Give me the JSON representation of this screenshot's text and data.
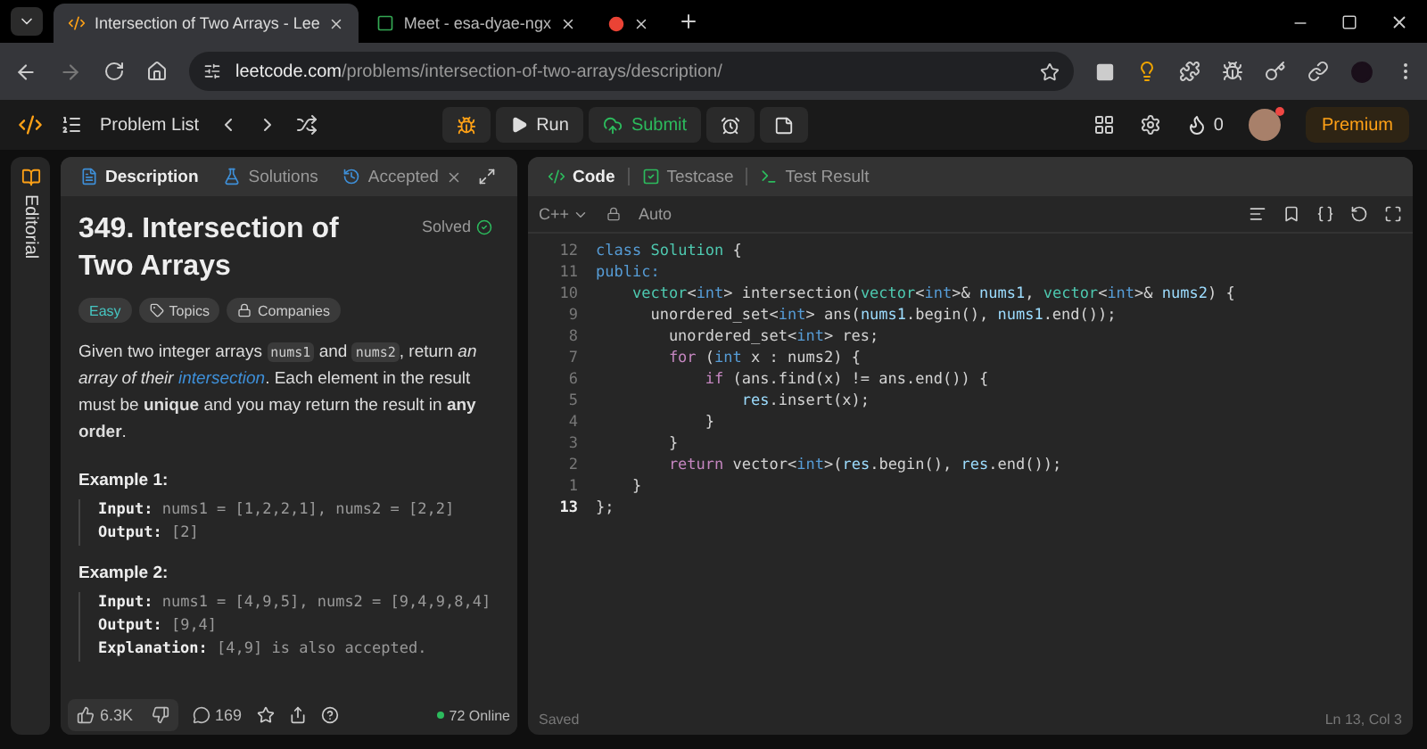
{
  "browser": {
    "tabs": [
      {
        "title": "Intersection of Two Arrays - Lee",
        "kind": "leetcode",
        "selected": true
      },
      {
        "title": "Meet - esa-dyae-ngx",
        "kind": "meet",
        "selected": false
      },
      {
        "kind": "recording",
        "selected": false
      }
    ],
    "url": {
      "domain": "leetcode.com",
      "path": "/problems/intersection-of-two-arrays/description/"
    }
  },
  "nav": {
    "problem_list": "Problem List",
    "run": "Run",
    "submit": "Submit",
    "streak": "0",
    "premium": "Premium"
  },
  "side_tab": "Editorial",
  "problem": {
    "tabs": [
      {
        "label": "Description",
        "kind": "description",
        "selected": true
      },
      {
        "label": "Solutions",
        "kind": "solutions",
        "selected": false
      },
      {
        "label": "Accepted",
        "kind": "accepted",
        "selected": false
      }
    ],
    "title": "349. Intersection of Two Arrays",
    "status": "Solved",
    "tags": [
      {
        "label": "Easy",
        "kind": "difficulty"
      },
      {
        "label": "Topics",
        "kind": "topics"
      },
      {
        "label": "Companies",
        "kind": "companies"
      }
    ],
    "description": [
      {
        "kind": "text",
        "text": "Given two integer arrays "
      },
      {
        "kind": "code",
        "text": "nums1"
      },
      {
        "kind": "text",
        "text": " and "
      },
      {
        "kind": "code",
        "text": "nums2"
      },
      {
        "kind": "text",
        "text": ", return *an array of their* "
      },
      {
        "kind": "link",
        "text": "intersection"
      },
      {
        "kind": "text",
        "text": ". Each element in the result must be **unique** and you may return the result in **any order**."
      }
    ],
    "examples": [
      {
        "title": "Example 1:",
        "lines": [
          {
            "label": "Input:",
            "value": "nums1 = [1,2,2,1], nums2 = [2,2]"
          },
          {
            "label": "Output:",
            "value": "[2]"
          }
        ]
      },
      {
        "title": "Example 2:",
        "lines": [
          {
            "label": "Input:",
            "value": "nums1 = [4,9,5], nums2 = [9,4,9,8,4]"
          },
          {
            "label": "Output:",
            "value": "[9,4]"
          },
          {
            "label": "Explanation:",
            "value": "[4,9] is also accepted."
          }
        ]
      }
    ],
    "footer": {
      "likes": "6.3K",
      "comments": "169",
      "online": "72 Online"
    }
  },
  "editor": {
    "tabs": [
      {
        "label": "Code",
        "kind": "code",
        "selected": true
      },
      {
        "label": "Testcase",
        "kind": "testcase",
        "selected": false
      },
      {
        "label": "Test Result",
        "kind": "result",
        "selected": false
      }
    ],
    "language": "C++",
    "mode": "Auto",
    "lines": [
      {
        "number": "12",
        "current": false,
        "tokens": [
          {
            "kind": "keyword",
            "t": "class "
          },
          {
            "kind": "type",
            "t": "Solution"
          },
          {
            "kind": "plain",
            "t": " {"
          }
        ]
      },
      {
        "number": "11",
        "current": false,
        "tokens": [
          {
            "kind": "keyword",
            "t": "public:"
          }
        ]
      },
      {
        "number": "10",
        "current": false,
        "tokens": [
          {
            "kind": "type",
            "t": "    vector"
          },
          {
            "kind": "plain",
            "t": "<"
          },
          {
            "kind": "keyword",
            "t": "int"
          },
          {
            "kind": "plain",
            "t": "> intersection("
          },
          {
            "kind": "type",
            "t": "vector"
          },
          {
            "kind": "plain",
            "t": "<"
          },
          {
            "kind": "keyword",
            "t": "int"
          },
          {
            "kind": "plain",
            "t": ">& "
          },
          {
            "kind": "variable",
            "t": "nums1"
          },
          {
            "kind": "plain",
            "t": ", "
          },
          {
            "kind": "type",
            "t": "vector"
          },
          {
            "kind": "plain",
            "t": "<"
          },
          {
            "kind": "keyword",
            "t": "int"
          },
          {
            "kind": "plain",
            "t": ">& "
          },
          {
            "kind": "variable",
            "t": "nums2"
          },
          {
            "kind": "plain",
            "t": ") {"
          }
        ]
      },
      {
        "number": "9",
        "current": false,
        "tokens": [
          {
            "kind": "plain",
            "t": "      unordered_set<"
          },
          {
            "kind": "keyword",
            "t": "int"
          },
          {
            "kind": "plain",
            "t": "> ans("
          },
          {
            "kind": "variable",
            "t": "nums1"
          },
          {
            "kind": "plain",
            "t": ".begin(), "
          },
          {
            "kind": "variable",
            "t": "nums1"
          },
          {
            "kind": "plain",
            "t": ".end());"
          }
        ]
      },
      {
        "number": "8",
        "current": false,
        "tokens": [
          {
            "kind": "plain",
            "t": "        unordered_set<"
          },
          {
            "kind": "keyword",
            "t": "int"
          },
          {
            "kind": "plain",
            "t": "> res;"
          }
        ]
      },
      {
        "number": "7",
        "current": false,
        "tokens": [
          {
            "kind": "control",
            "t": "        for"
          },
          {
            "kind": "plain",
            "t": " ("
          },
          {
            "kind": "keyword",
            "t": "int"
          },
          {
            "kind": "plain",
            "t": " x : nums2) {"
          }
        ]
      },
      {
        "number": "6",
        "current": false,
        "tokens": [
          {
            "kind": "control",
            "t": "            if"
          },
          {
            "kind": "plain",
            "t": " (ans.find(x) != ans.end()) {"
          }
        ]
      },
      {
        "number": "5",
        "current": false,
        "tokens": [
          {
            "kind": "variable",
            "t": "                res"
          },
          {
            "kind": "plain",
            "t": ".insert(x);"
          }
        ]
      },
      {
        "number": "4",
        "current": false,
        "tokens": [
          {
            "kind": "plain",
            "t": "            }"
          }
        ]
      },
      {
        "number": "3",
        "current": false,
        "tokens": [
          {
            "kind": "plain",
            "t": "        }"
          }
        ]
      },
      {
        "number": "2",
        "current": false,
        "tokens": [
          {
            "kind": "control",
            "t": "        return"
          },
          {
            "kind": "plain",
            "t": " vector<"
          },
          {
            "kind": "keyword",
            "t": "int"
          },
          {
            "kind": "plain",
            "t": ">("
          },
          {
            "kind": "variable",
            "t": "res"
          },
          {
            "kind": "plain",
            "t": ".begin(), "
          },
          {
            "kind": "variable",
            "t": "res"
          },
          {
            "kind": "plain",
            "t": ".end());"
          }
        ]
      },
      {
        "number": "1",
        "current": false,
        "tokens": [
          {
            "kind": "plain",
            "t": "    }"
          }
        ]
      },
      {
        "number": "13",
        "current": true,
        "tokens": [
          {
            "kind": "plain",
            "t": "};"
          }
        ]
      }
    ],
    "saved": "Saved",
    "position": "Ln 13, Col 3"
  }
}
